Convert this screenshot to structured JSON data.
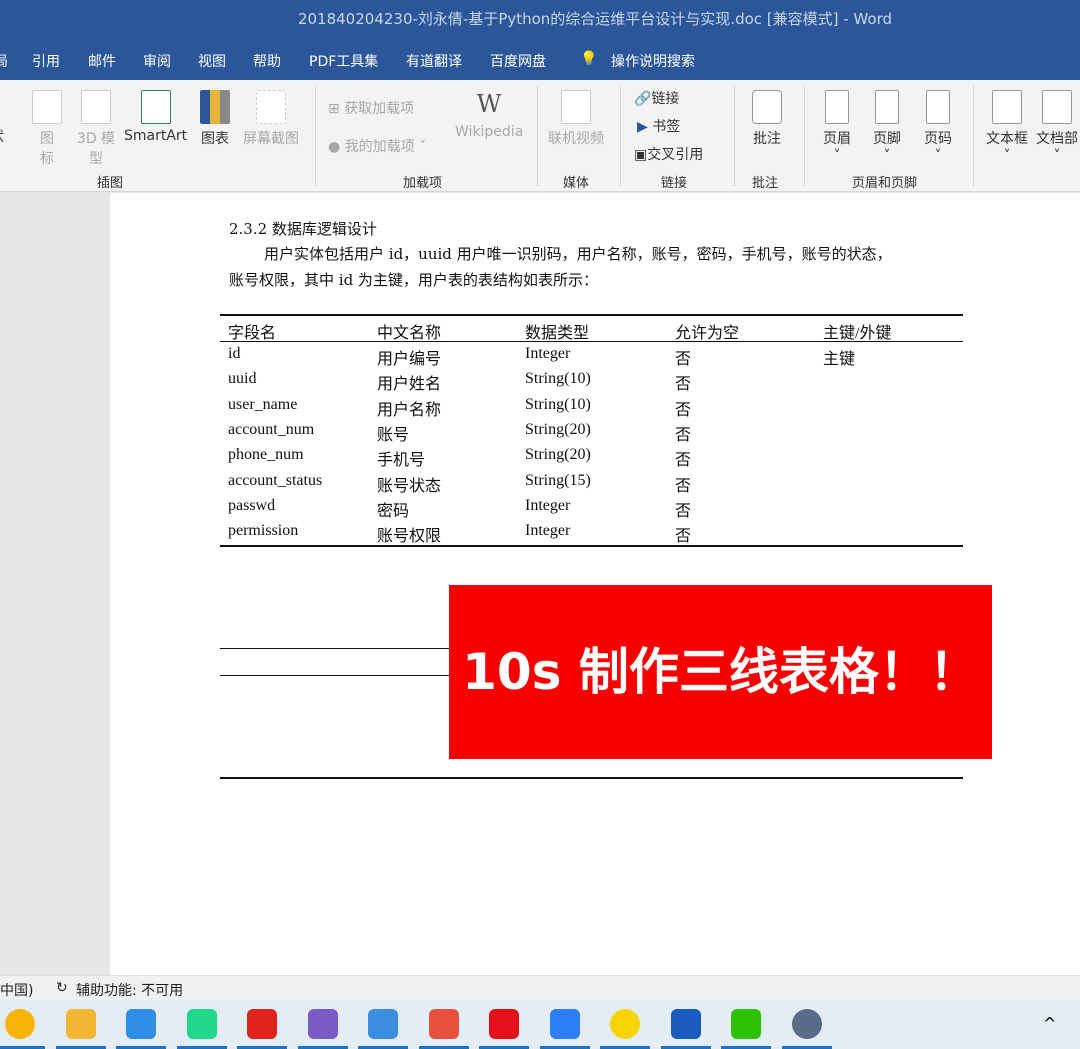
{
  "window": {
    "title": "201840204230-刘永倩-基于Python的综合运维平台设计与实现.doc [兼容模式]  -  Word"
  },
  "menu": {
    "items": [
      "局",
      "引用",
      "邮件",
      "审阅",
      "视图",
      "帮助",
      "PDF工具集",
      "有道翻译",
      "百度网盘"
    ],
    "search": "操作说明搜索"
  },
  "ribbon": {
    "illustrations": {
      "items": [
        "状",
        "图标",
        "3D 模型",
        "SmartArt",
        "图表",
        "屏幕截图"
      ],
      "group": "插图"
    },
    "addins": {
      "get": "获取加载项",
      "mine": "我的加载项",
      "wikipedia": "Wikipedia",
      "group": "加载项"
    },
    "media": {
      "video": "联机视频",
      "group": "媒体"
    },
    "links": {
      "link": "链接",
      "bookmark": "书签",
      "crossref": "交叉引用",
      "group": "链接"
    },
    "comments": {
      "comment": "批注",
      "group": "批注"
    },
    "headerfooter": {
      "header": "页眉",
      "footer": "页脚",
      "pagenum": "页码",
      "group": "页眉和页脚"
    },
    "text": {
      "textbox": "文本框",
      "docparts": "文档部"
    }
  },
  "document": {
    "heading": "2.3.2 数据库逻辑设计",
    "para1": "用户实体包括用户 id，uuid 用户唯一识别码，用户名称，账号，密码，手机号，账号的状态，",
    "para2": "账号权限，其中 id 为主键，用户表的表结构如表所示：",
    "table": {
      "headers": [
        "字段名",
        "中文名称",
        "数据类型",
        "允许为空",
        "主键/外键"
      ],
      "rows": [
        [
          "id",
          "用户编号",
          "Integer",
          "否",
          "主键"
        ],
        [
          "uuid",
          "用户姓名",
          "String(10)",
          "否",
          ""
        ],
        [
          "user_name",
          "用户名称",
          "String(10)",
          "否",
          ""
        ],
        [
          "account_num",
          "账号",
          "String(20)",
          "否",
          ""
        ],
        [
          "phone_num",
          "手机号",
          "String(20)",
          "否",
          ""
        ],
        [
          "account_status",
          "账号状态",
          "String(15)",
          "否",
          ""
        ],
        [
          "passwd",
          "密码",
          "Integer",
          "否",
          ""
        ],
        [
          "permission",
          "账号权限",
          "Integer",
          "否",
          ""
        ]
      ]
    },
    "overlay": "10s 制作三线表格！！"
  },
  "status": {
    "lang": "中国)",
    "accessibility": "辅助功能: 不可用"
  },
  "taskbar": {
    "apps": [
      "chrome",
      "explorer",
      "files",
      "pycharm",
      "wps",
      "paint",
      "baidu",
      "netease",
      "youdao",
      "feishu",
      "music",
      "word",
      "wechat",
      "avatar"
    ],
    "colors": [
      "#f4b400",
      "#f2b632",
      "#2f8de4",
      "#21d789",
      "#e0241b",
      "#7a5bc5",
      "#3c8de0",
      "#e8513b",
      "#e4101a",
      "#2d7ff9",
      "#f6d400",
      "#185abd",
      "#2dc100",
      "#5a6b88"
    ]
  }
}
